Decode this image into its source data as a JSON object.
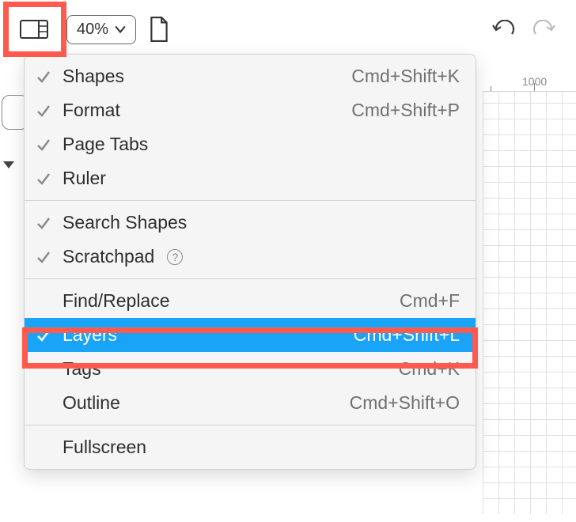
{
  "toolbar": {
    "zoom_level": "40%"
  },
  "ruler": {
    "mark_a": "",
    "mark_b": "1000"
  },
  "menu": {
    "items": [
      {
        "label": "Shapes",
        "shortcut": "Cmd+Shift+K",
        "checked": true
      },
      {
        "label": "Format",
        "shortcut": "Cmd+Shift+P",
        "checked": true
      },
      {
        "label": "Page Tabs",
        "shortcut": "",
        "checked": true
      },
      {
        "label": "Ruler",
        "shortcut": "",
        "checked": true
      },
      {
        "sep": true
      },
      {
        "label": "Search Shapes",
        "shortcut": "",
        "checked": true
      },
      {
        "label": "Scratchpad",
        "shortcut": "",
        "checked": true,
        "help": true
      },
      {
        "sep": true
      },
      {
        "label": "Find/Replace",
        "shortcut": "Cmd+F",
        "checked": false
      },
      {
        "label": "Layers",
        "shortcut": "Cmd+Shift+L",
        "checked": true,
        "selected": true
      },
      {
        "label": "Tags",
        "shortcut": "Cmd+K",
        "checked": false
      },
      {
        "label": "Outline",
        "shortcut": "Cmd+Shift+O",
        "checked": false
      },
      {
        "sep": true
      },
      {
        "label": "Fullscreen",
        "shortcut": "",
        "checked": false
      }
    ]
  },
  "help_glyph": "?"
}
